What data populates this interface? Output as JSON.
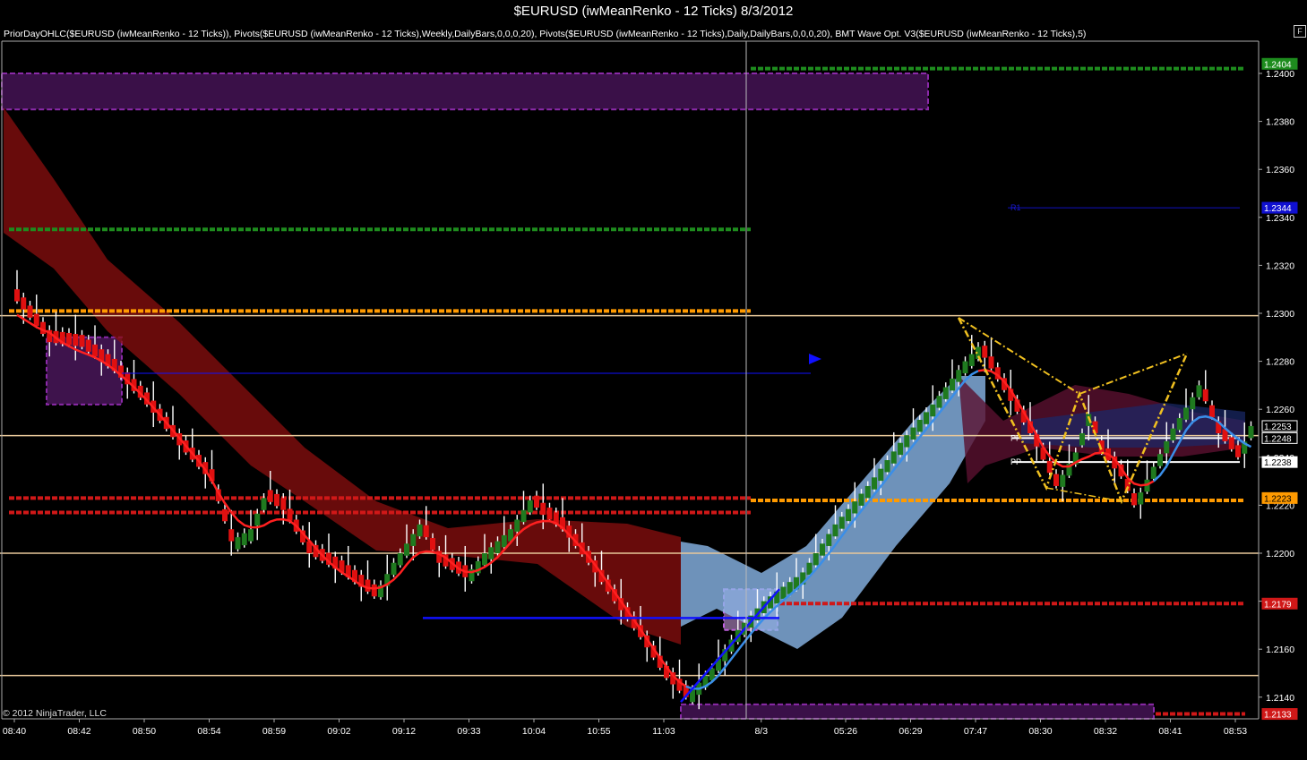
{
  "window": {
    "title": "$EURUSD (iwMeanRenko - 12 Ticks)  8/3/2012",
    "f_button": "F",
    "indicator_text": "PriorDayOHLC($EURUSD (iwMeanRenko - 12 Ticks)), Pivots($EURUSD (iwMeanRenko - 12 Ticks),Weekly,DailyBars,0,0,0,20), Pivots($EURUSD (iwMeanRenko - 12 Ticks),Daily,DailyBars,0,0,0,20), BMT Wave Opt. V3($EURUSD (iwMeanRenko - 12 Ticks),5)",
    "copyright": "© 2012 NinjaTrader, LLC"
  },
  "colors": {
    "background": "#000000",
    "up_bar": "#1f7a1f",
    "down_bar": "#e01010",
    "wick": "#ffffff",
    "red_ribbon": "#8b0f0f",
    "blue_ribbon": "#8ab6e8",
    "signal_line_red": "#ff2020",
    "signal_line_blue": "#3a8ee8",
    "pivot_green": "#1e8c1e",
    "pivot_orange": "#ff9a00",
    "pivot_red": "#d01818",
    "pivot_tan": "#e8c89a",
    "purple_zone": "#8a2aa8",
    "pattern_yellow": "#f0c020",
    "arrow_blue": "#1010ff"
  },
  "chart_data": {
    "type": "candlestick",
    "instrument": "$EURUSD",
    "bar_type": "iwMeanRenko - 12 Ticks",
    "date": "8/3/2012",
    "ylim": [
      1.2124,
      1.2409
    ],
    "y_ticks": [
      "1.2400",
      "1.2380",
      "1.2360",
      "1.2340",
      "1.2320",
      "1.2300",
      "1.2280",
      "1.2260",
      "1.2240",
      "1.2220",
      "1.2200",
      "1.2180",
      "1.2160",
      "1.2140"
    ],
    "x_ticks": [
      {
        "label": "08:40",
        "bar": 0
      },
      {
        "label": "08:42",
        "bar": 10
      },
      {
        "label": "08:50",
        "bar": 20
      },
      {
        "label": "08:54",
        "bar": 30
      },
      {
        "label": "08:59",
        "bar": 40
      },
      {
        "label": "09:02",
        "bar": 50
      },
      {
        "label": "09:12",
        "bar": 60
      },
      {
        "label": "09:33",
        "bar": 70
      },
      {
        "label": "10:04",
        "bar": 80
      },
      {
        "label": "10:55",
        "bar": 90
      },
      {
        "label": "11:03",
        "bar": 100
      },
      {
        "label": "8/3",
        "bar": 115
      },
      {
        "label": "05:26",
        "bar": 128
      },
      {
        "label": "06:29",
        "bar": 138
      },
      {
        "label": "07:47",
        "bar": 148
      },
      {
        "label": "08:30",
        "bar": 158
      },
      {
        "label": "08:32",
        "bar": 168
      },
      {
        "label": "08:41",
        "bar": 178
      },
      {
        "label": "08:53",
        "bar": 188
      }
    ],
    "close_path_anchors": [
      [
        0,
        1.2305
      ],
      [
        5,
        1.2288
      ],
      [
        10,
        1.2286
      ],
      [
        15,
        1.2276
      ],
      [
        20,
        1.2262
      ],
      [
        25,
        1.2245
      ],
      [
        30,
        1.223
      ],
      [
        33,
        1.2205
      ],
      [
        36,
        1.221
      ],
      [
        38,
        1.2223
      ],
      [
        41,
        1.2218
      ],
      [
        45,
        1.22
      ],
      [
        50,
        1.2192
      ],
      [
        55,
        1.2182
      ],
      [
        58,
        1.2196
      ],
      [
        62,
        1.2212
      ],
      [
        65,
        1.2196
      ],
      [
        69,
        1.219
      ],
      [
        72,
        1.22
      ],
      [
        76,
        1.221
      ],
      [
        79,
        1.2222
      ],
      [
        81,
        1.2216
      ],
      [
        84,
        1.221
      ],
      [
        88,
        1.2196
      ],
      [
        92,
        1.218
      ],
      [
        96,
        1.2165
      ],
      [
        100,
        1.2148
      ],
      [
        103,
        1.214
      ],
      [
        107,
        1.2152
      ],
      [
        111,
        1.2168
      ],
      [
        115,
        1.218
      ],
      [
        121,
        1.2192
      ],
      [
        126,
        1.2212
      ],
      [
        131,
        1.2228
      ],
      [
        136,
        1.2246
      ],
      [
        141,
        1.2262
      ],
      [
        146,
        1.228
      ],
      [
        148,
        1.2286
      ],
      [
        152,
        1.2268
      ],
      [
        156,
        1.225
      ],
      [
        160,
        1.2228
      ],
      [
        163,
        1.2242
      ],
      [
        165,
        1.2258
      ],
      [
        167,
        1.2242
      ],
      [
        170,
        1.2232
      ],
      [
        172,
        1.222
      ],
      [
        175,
        1.2236
      ],
      [
        178,
        1.2252
      ],
      [
        181,
        1.2265
      ],
      [
        182,
        1.227
      ],
      [
        185,
        1.225
      ],
      [
        188,
        1.224
      ],
      [
        190,
        1.2253
      ]
    ],
    "horizontal_levels": [
      {
        "price": 1.2402,
        "color": "pivot_green",
        "style": "dashed",
        "x_from": 838,
        "x_to": 1390
      },
      {
        "price": 1.2335,
        "color": "pivot_green",
        "style": "dashed",
        "x_from": 10,
        "x_to": 838
      },
      {
        "price": 1.2301,
        "color": "pivot_orange",
        "style": "dashed",
        "x_from": 10,
        "x_to": 838
      },
      {
        "price": 1.2299,
        "color": "pivot_tan",
        "style": "solid",
        "x_from": 0,
        "x_to": 1405
      },
      {
        "price": 1.2249,
        "color": "pivot_tan",
        "style": "solid",
        "x_from": 0,
        "x_to": 1405
      },
      {
        "price": 1.2223,
        "color": "pivot_red",
        "style": "dashed",
        "x_from": 10,
        "x_to": 838
      },
      {
        "price": 1.2222,
        "color": "pivot_orange",
        "style": "dashed",
        "x_from": 838,
        "x_to": 1390
      },
      {
        "price": 1.2217,
        "color": "pivot_red",
        "style": "dashed",
        "x_from": 10,
        "x_to": 838
      },
      {
        "price": 1.22,
        "color": "pivot_tan",
        "style": "solid",
        "x_from": 0,
        "x_to": 1405
      },
      {
        "price": 1.2179,
        "color": "pivot_red",
        "style": "dashed",
        "x_from": 870,
        "x_to": 1390
      },
      {
        "price": 1.2149,
        "color": "pivot_tan",
        "style": "solid",
        "x_from": 0,
        "x_to": 1405
      },
      {
        "price": 1.2133,
        "color": "pivot_red",
        "style": "dashed",
        "x_from": 1290,
        "x_to": 1390
      }
    ],
    "level_labels": [
      {
        "text": "R1",
        "price": 1.2344
      },
      {
        "text": "PP",
        "price": 1.2248
      },
      {
        "text": "PP",
        "price": 1.2238
      }
    ],
    "price_tags": [
      {
        "price": "1.2404",
        "color": "#1e8c1e"
      },
      {
        "price": "1.2344",
        "color": "#1010d0"
      },
      {
        "price": "1.2253",
        "color": "#000000"
      },
      {
        "price": "1.2248",
        "color": "#000000"
      },
      {
        "price": "1.2238",
        "color": "#ffffff"
      },
      {
        "price": "1.2223",
        "color": "#ff9a00"
      },
      {
        "price": "1.2179",
        "color": "#d01818"
      },
      {
        "price": "1.2133",
        "color": "#d01818"
      }
    ]
  }
}
